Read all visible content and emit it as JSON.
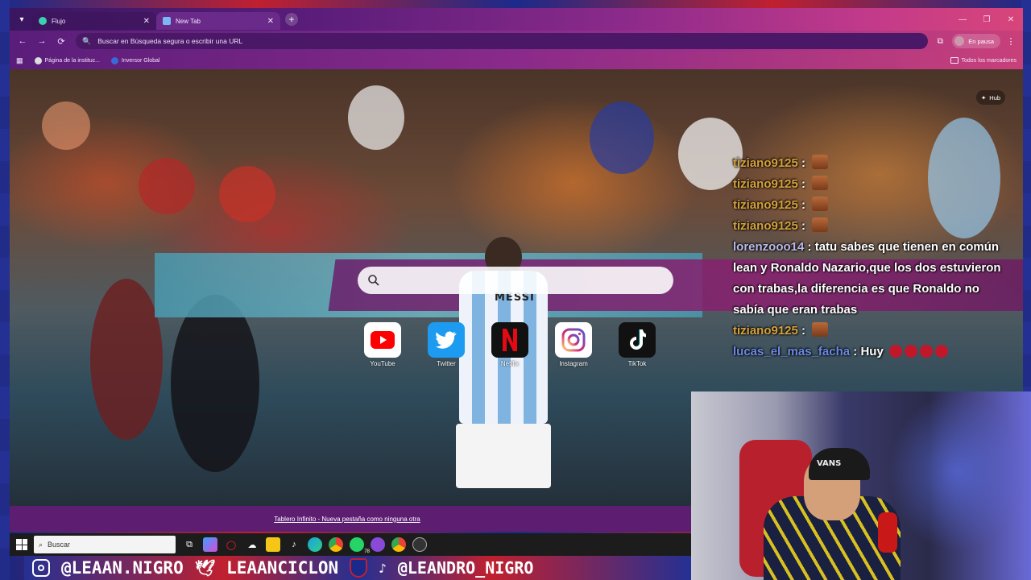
{
  "browser": {
    "tabs": [
      {
        "title": "Flujo",
        "active": false
      },
      {
        "title": "New Tab",
        "active": true
      }
    ],
    "new_tab_symbol": "+",
    "omnibox_placeholder": "Buscar en Búsqueda segura o escribir una URL",
    "profile_label": "En pausa",
    "bookmarks": [
      {
        "label": "Página de la instituc..."
      },
      {
        "label": "Inversor Global"
      }
    ],
    "all_bookmarks_label": "Todos los marcadores"
  },
  "ntp": {
    "hub_label": "Hub",
    "shortcuts": [
      {
        "label": "YouTube",
        "icon": "youtube-icon",
        "color": "#ff0000"
      },
      {
        "label": "Twitter",
        "icon": "twitter-icon",
        "color": "#1d9bf0"
      },
      {
        "label": "Netflix",
        "icon": "netflix-icon",
        "color": "#e50914"
      },
      {
        "label": "Instagram",
        "icon": "instagram-icon",
        "color": "#d62976"
      },
      {
        "label": "TikTok",
        "icon": "tiktok-icon",
        "color": "#000000"
      }
    ],
    "footer_link": "Tablero Infinito - Nueva pestaña como ninguna otra",
    "jersey_name": "MESSI"
  },
  "chat": {
    "messages": [
      {
        "user": "tiziano9125",
        "sep": " :",
        "text": "",
        "user_color": "#d6a23a",
        "emotes": 1
      },
      {
        "user": "tiziano9125",
        "sep": " :",
        "text": "",
        "user_color": "#d6a23a",
        "emotes": 1
      },
      {
        "user": "tiziano9125",
        "sep": " :",
        "text": "",
        "user_color": "#d6a23a",
        "emotes": 1
      },
      {
        "user": "tiziano9125",
        "sep": " :",
        "text": "",
        "user_color": "#d6a23a",
        "emotes": 1
      },
      {
        "user": "lorenzooo14",
        "sep": " :",
        "text": " tatu sabes que tienen en común lean y Ronaldo Nazario,que los dos estuvieron con trabas,la diferencia es que Ronaldo no sabía que eran trabas",
        "user_color": "#b9b9e8",
        "emotes": 0
      },
      {
        "user": "tiziano9125",
        "sep": " :",
        "text": "",
        "user_color": "#d6a23a",
        "emotes": 1
      },
      {
        "user": "lucas_el_mas_facha",
        "sep": " :",
        "text": " Huy",
        "user_color": "#6a8ae8",
        "emotes": 0,
        "rage": 4
      }
    ]
  },
  "webcam": {
    "cap_text": "VANS"
  },
  "taskbar": {
    "search_placeholder": "Buscar",
    "whatsapp_badge": "78"
  },
  "social": {
    "instagram_handle": "@LEAAN.NIGRO",
    "kick_handle": "LEAANCICLON",
    "tiktok_handle": "@LEANDRO_NIGRO"
  },
  "colors": {
    "accent": "#5d1e72",
    "team_blue": "#243093",
    "team_red": "#c0202f"
  }
}
